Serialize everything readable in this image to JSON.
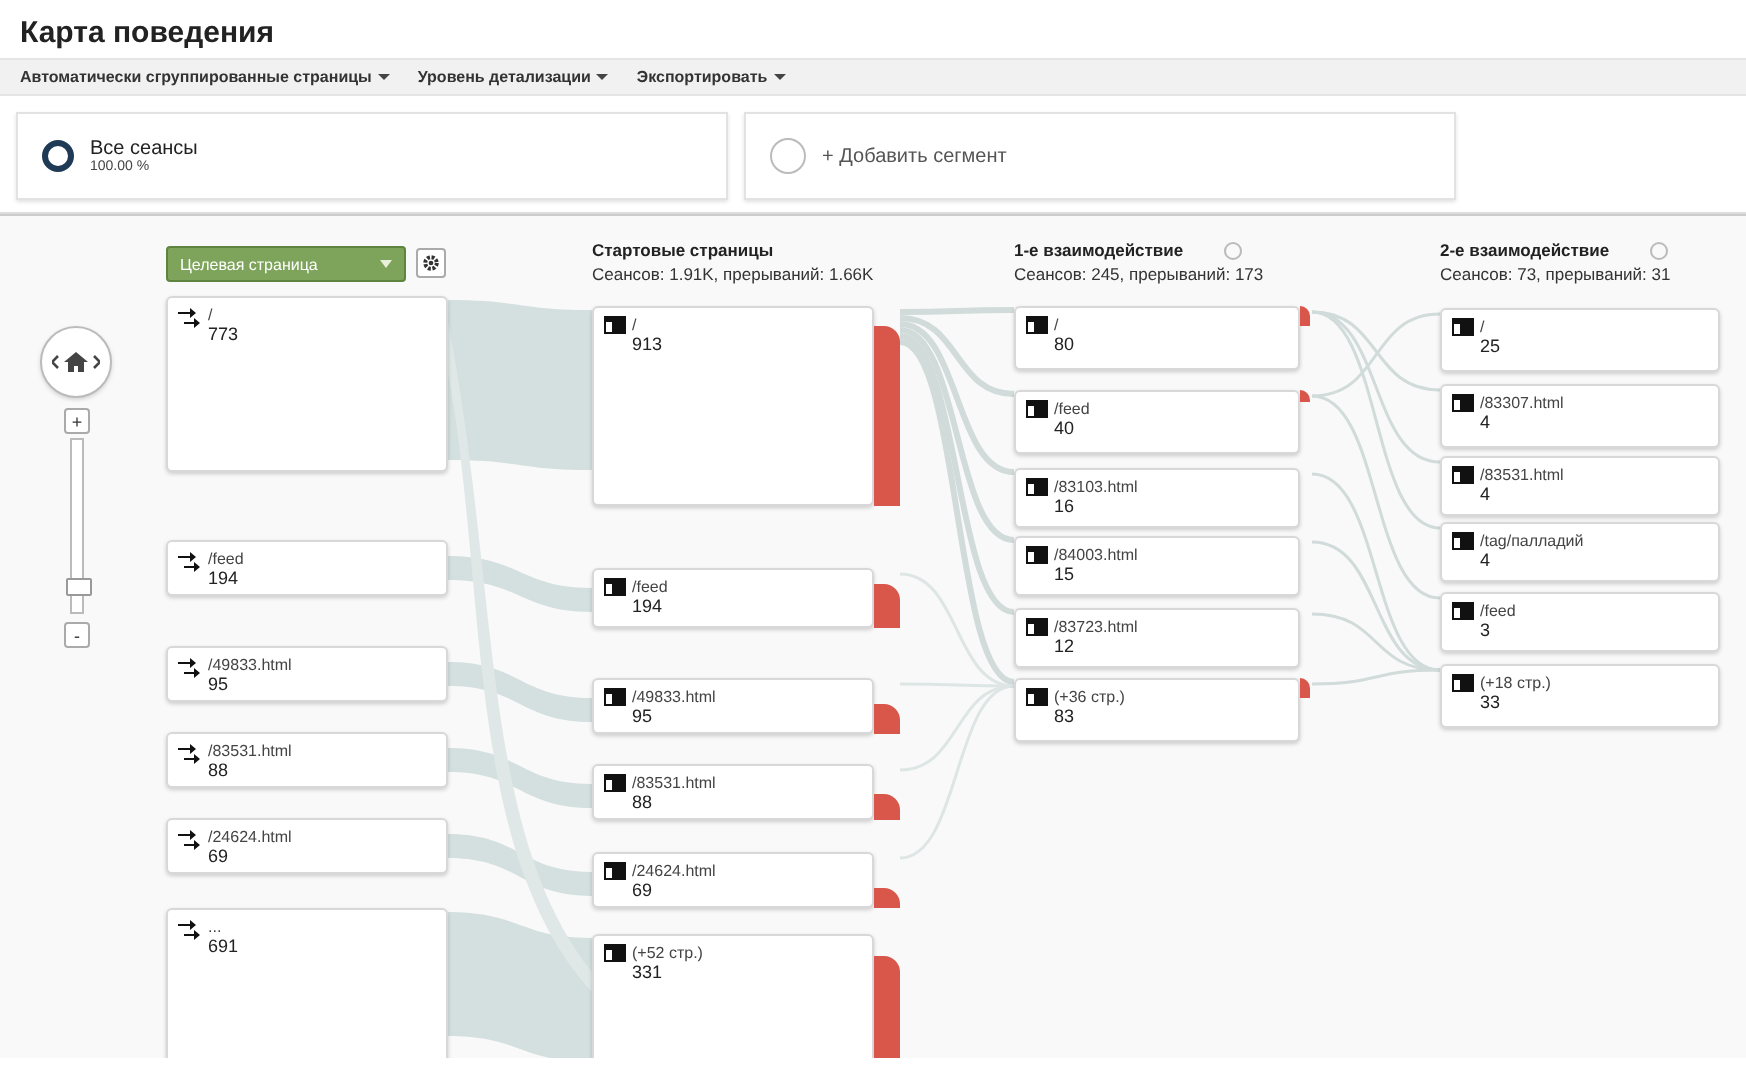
{
  "page_title": "Карта поведения",
  "toolbar": [
    {
      "label": "Автоматически сгруппированные страницы"
    },
    {
      "label": "Уровень детализации"
    },
    {
      "label": "Экспортировать"
    }
  ],
  "segments": [
    {
      "name": "Все сеансы",
      "percent": "100.00 %",
      "selected": true
    },
    {
      "name": "+ Добавить сегмент",
      "selected": false
    }
  ],
  "zoom": {
    "zoom_in": "+",
    "zoom_out": "-",
    "level": 0.1
  },
  "dimension_dropdown": {
    "value": "Целевая страница"
  },
  "columns": [
    {
      "kind": "landing",
      "nodes": [
        {
          "label": "/",
          "count": "773"
        },
        {
          "label": "/feed",
          "count": "194"
        },
        {
          "label": "/49833.html",
          "count": "95"
        },
        {
          "label": "/83531.html",
          "count": "88"
        },
        {
          "label": "/24624.html",
          "count": "69"
        },
        {
          "label": "...",
          "count": "691"
        }
      ]
    },
    {
      "kind": "start",
      "title": "Стартовые страницы",
      "summary": "Сеансов: 1.91K, прерываний: 1.66K",
      "nodes": [
        {
          "label": "/",
          "count": "913"
        },
        {
          "label": "/feed",
          "count": "194"
        },
        {
          "label": "/49833.html",
          "count": "95"
        },
        {
          "label": "/83531.html",
          "count": "88"
        },
        {
          "label": "/24624.html",
          "count": "69"
        },
        {
          "label": "(+52 стр.)",
          "count": "331"
        }
      ]
    },
    {
      "kind": "interaction",
      "title": "1-е взаимодействие",
      "summary": "Сеансов: 245, прерываний: 173",
      "nodes": [
        {
          "label": "/",
          "count": "80"
        },
        {
          "label": "/feed",
          "count": "40"
        },
        {
          "label": "/83103.html",
          "count": "16"
        },
        {
          "label": "/84003.html",
          "count": "15"
        },
        {
          "label": "/83723.html",
          "count": "12"
        },
        {
          "label": "(+36 стр.)",
          "count": "83"
        }
      ]
    },
    {
      "kind": "interaction",
      "title": "2-е взаимодействие",
      "summary": "Сеансов: 73, прерываний: 31",
      "nodes": [
        {
          "label": "/",
          "count": "25"
        },
        {
          "label": "/83307.html",
          "count": "4"
        },
        {
          "label": "/83531.html",
          "count": "4"
        },
        {
          "label": "/tag/палладий",
          "count": "4"
        },
        {
          "label": "/feed",
          "count": "3"
        },
        {
          "label": "(+18 стр.)",
          "count": "33"
        }
      ]
    }
  ]
}
